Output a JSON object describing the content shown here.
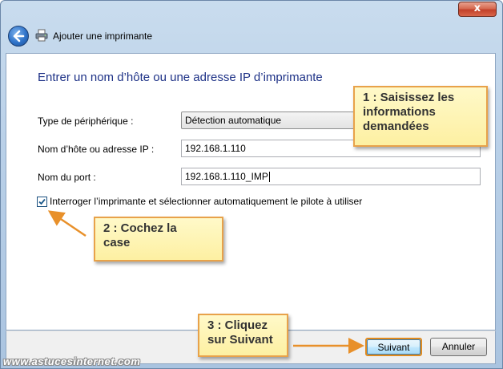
{
  "window": {
    "title": "Ajouter une imprimante",
    "close_label": "x"
  },
  "heading": "Entrer un nom d’hôte ou une adresse IP d’imprimante",
  "form": {
    "device_type_label": "Type de périphérique :",
    "device_type_value": "Détection automatique",
    "hostname_label": "Nom d’hôte ou adresse IP :",
    "hostname_value": "192.168.1.110",
    "port_label": "Nom du port :",
    "port_value": "192.168.1.110_IMP",
    "auto_query_checked": true,
    "auto_query_label": "Interroger l’imprimante et sélectionner automatiquement le pilote à utiliser"
  },
  "buttons": {
    "next": "Suivant",
    "cancel": "Annuler"
  },
  "callouts": {
    "step1": "1 : Saisissez les\ninformations\ndemandées",
    "step2": "2 : Cochez la\ncase",
    "step3": "3 : Cliquez\nsur Suivant"
  },
  "watermark": "www.astucesinternet.com",
  "colors": {
    "heading": "#1e3287",
    "callout_fill": "#fdf0a2",
    "callout_border": "#e8a24a",
    "arrow": "#e8902a"
  },
  "icons": [
    "back-arrow-icon",
    "printer-icon",
    "checkmark-icon",
    "chevron-down-icon"
  ]
}
